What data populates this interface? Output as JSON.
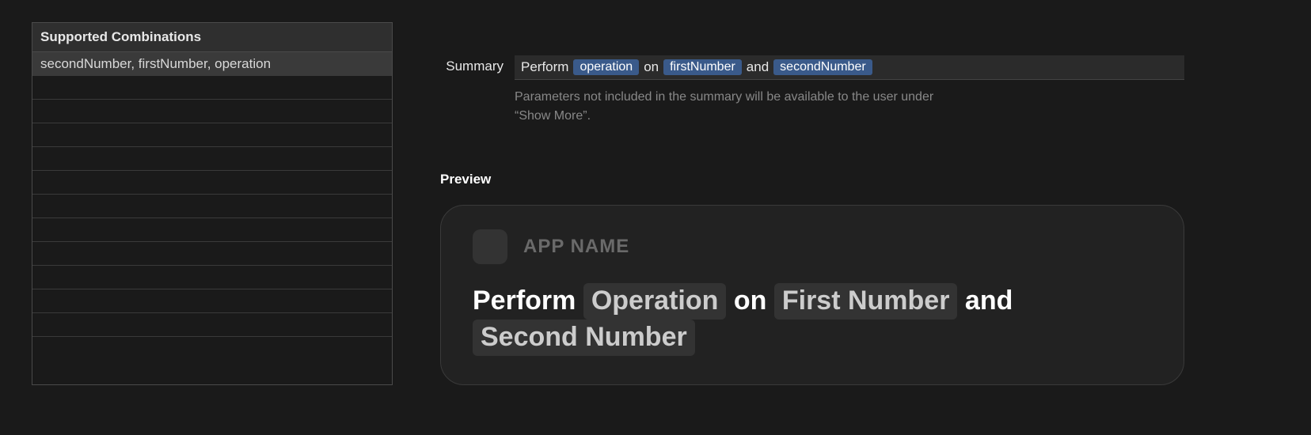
{
  "table": {
    "header": "Supported Combinations",
    "rows": [
      "secondNumber, firstNumber, operation",
      "",
      "",
      "",
      "",
      "",
      "",
      "",
      "",
      "",
      "",
      "",
      ""
    ]
  },
  "summary": {
    "label": "Summary",
    "parts": {
      "p0": "Perform",
      "t0": "operation",
      "p1": "on",
      "t1": "firstNumber",
      "p2": "and",
      "t2": "secondNumber"
    },
    "help": "Parameters not included in the summary will be available to the user under “Show More”."
  },
  "preview": {
    "label": "Preview",
    "appName": "APP NAME",
    "parts": {
      "p0": "Perform",
      "t0": "Operation",
      "p1": "on",
      "t1": "First Number",
      "p2": "and",
      "t2": "Second Number"
    }
  }
}
